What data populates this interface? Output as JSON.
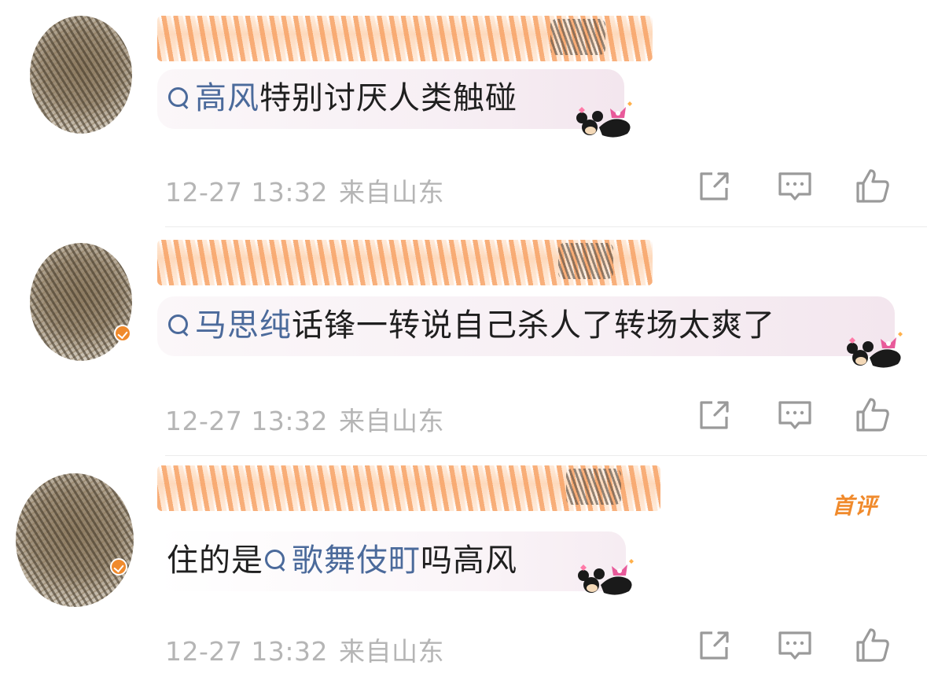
{
  "comments": [
    {
      "text_parts": [
        {
          "type": "topic",
          "text": "高风"
        },
        {
          "type": "plain",
          "text": "特别讨厌人类触碰"
        }
      ],
      "time": "12-27 13:32",
      "location": "来自山东",
      "first_badge": null
    },
    {
      "text_parts": [
        {
          "type": "topic",
          "text": "马思纯"
        },
        {
          "type": "plain",
          "text": "话锋一转说自己杀人了转场太爽了"
        }
      ],
      "time": "12-27 13:32",
      "location": "来自山东",
      "first_badge": null
    },
    {
      "text_parts": [
        {
          "type": "plain",
          "text": "住的是"
        },
        {
          "type": "topic",
          "text": "歌舞伎町"
        },
        {
          "type": "plain",
          "text": "吗高风"
        }
      ],
      "time": "12-27 13:32",
      "location": "来自山东",
      "first_badge": "首评"
    }
  ],
  "icons": {
    "share": "share-icon",
    "comment": "comment-icon",
    "like": "thumbs-up-icon",
    "search": "search-icon",
    "sticker": "minnie-sticker"
  },
  "colors": {
    "topic": "#4b6a9b",
    "meta": "#b5b5b5",
    "accent": "#f08a2c"
  }
}
